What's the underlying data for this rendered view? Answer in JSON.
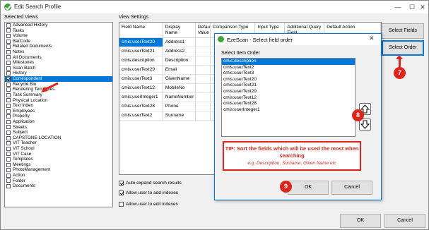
{
  "window": {
    "title": "Edit Search Profile"
  },
  "selected_views": {
    "label": "Selected Views",
    "items": [
      {
        "label": "Advanced History",
        "checked": false
      },
      {
        "label": "Tasks",
        "checked": false
      },
      {
        "label": "Volume",
        "checked": false
      },
      {
        "label": "BarCode",
        "checked": false
      },
      {
        "label": "Related Documents",
        "checked": false
      },
      {
        "label": "Notes",
        "checked": false
      },
      {
        "label": "All Documents",
        "checked": false
      },
      {
        "label": "Milestones",
        "checked": false
      },
      {
        "label": "Scan Batch",
        "checked": false
      },
      {
        "label": "History",
        "checked": false
      },
      {
        "label": "Correspondent",
        "checked": true,
        "selected": true
      },
      {
        "label": "Recycle Bin",
        "checked": false
      },
      {
        "label": "Rendering Templates",
        "checked": false
      },
      {
        "label": "Task Summary",
        "checked": false
      },
      {
        "label": "Physical Location",
        "checked": false
      },
      {
        "label": "Text Index",
        "checked": false
      },
      {
        "label": "Employees",
        "checked": false
      },
      {
        "label": "Property",
        "checked": false
      },
      {
        "label": "Application",
        "checked": false
      },
      {
        "label": "Streets",
        "checked": false
      },
      {
        "label": "Subject",
        "checked": false
      },
      {
        "label": "CAPSTONE-LOCATION",
        "checked": false
      },
      {
        "label": "VIT Teacher",
        "checked": false
      },
      {
        "label": "VIT School",
        "checked": false
      },
      {
        "label": "VIT Case",
        "checked": false
      },
      {
        "label": "Templates",
        "checked": false
      },
      {
        "label": "Meetings",
        "checked": false
      },
      {
        "label": "PhotoManagement",
        "checked": false
      },
      {
        "label": "Action",
        "checked": false
      },
      {
        "label": "Folder",
        "checked": false
      },
      {
        "label": "Documents",
        "checked": false
      }
    ]
  },
  "view_settings": {
    "label": "View Settings",
    "columns": [
      "Field Name",
      "Display Name",
      "Default Value",
      "Comparison Type",
      "Input Type",
      "Additional Query Field",
      "Default Action"
    ],
    "rows": [
      [
        "cmis:userText20",
        "Address1"
      ],
      [
        "cmis:userText21",
        "Address2"
      ],
      [
        "cmis:description",
        "Description"
      ],
      [
        "cmis:userText29",
        "Email"
      ],
      [
        "cmis:userText3",
        "GivenName"
      ],
      [
        "cmis:userText12",
        "MobileNo"
      ],
      [
        "cmis:userInteger1",
        "NameNumber"
      ],
      [
        "cmis:userText28",
        "Phone"
      ],
      [
        "cmis:userText2",
        "Surname"
      ]
    ]
  },
  "options": {
    "auto_expand": {
      "label": "Auto expand search results",
      "checked": true
    },
    "allow_add": {
      "label": "Allow user to add indexes",
      "checked": true
    },
    "allow_edit": {
      "label": "Allow user to edit indexes",
      "checked": false
    }
  },
  "buttons": {
    "select_fields": "Select Fields",
    "select_order": "Select Order",
    "ok": "OK",
    "cancel": "Cancel"
  },
  "dialog": {
    "title": "EzeScan - Select field order",
    "list_label": "Select Item Order",
    "items": [
      "cmis:description",
      "cmis:userText2",
      "cmis:userText3",
      "cmis:userText20",
      "cmis:userText21",
      "cmis:userText29",
      "cmis:userText12",
      "cmis:userText28",
      "cmis:userInteger1"
    ],
    "ok": "OK",
    "cancel": "Cancel"
  },
  "tip": {
    "heading": "TIP: Sort the fields which will be used the most when searching",
    "example": "e.g. Description, Surname, Given Name etc"
  },
  "badges": {
    "step7": "7",
    "step8": "8",
    "step9": "9"
  },
  "colors": {
    "annotation": "#e0241b",
    "selection": "#0078d7",
    "app_icon": "#3fa535"
  }
}
